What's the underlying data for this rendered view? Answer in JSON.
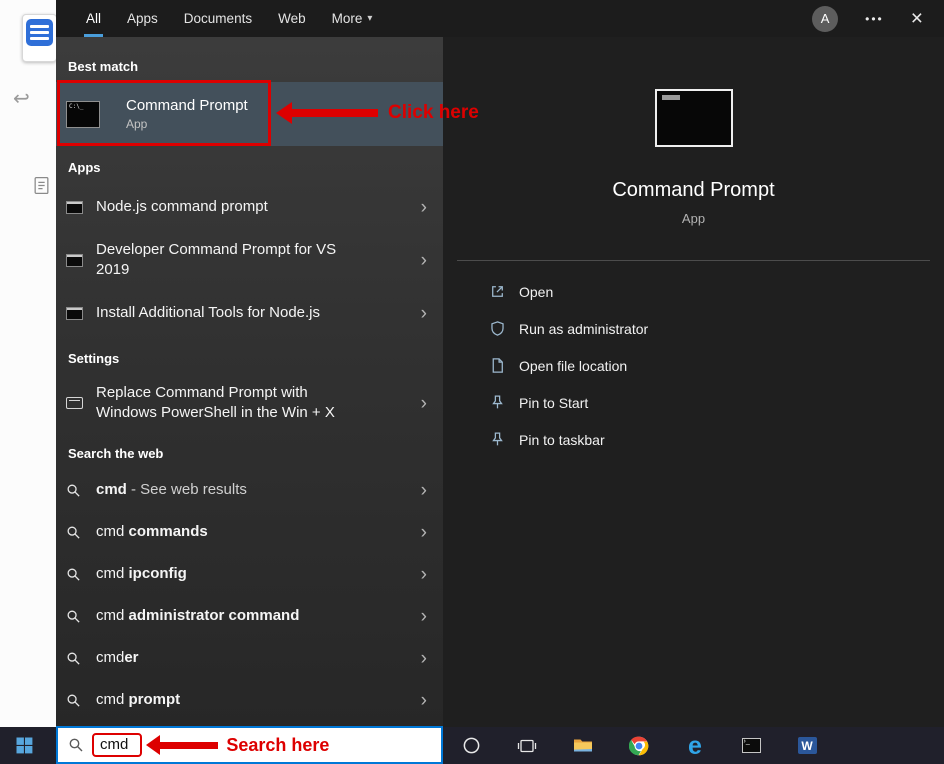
{
  "topbar": {
    "tabs": [
      {
        "label": "All",
        "selected": true
      },
      {
        "label": "Apps",
        "selected": false
      },
      {
        "label": "Documents",
        "selected": false
      },
      {
        "label": "Web",
        "selected": false
      },
      {
        "label": "More",
        "selected": false,
        "caret": "▾"
      }
    ],
    "avatar_letter": "A",
    "ellipsis_icon": "•••",
    "close_icon": "×"
  },
  "left_panel": {
    "best_match_header": "Best match",
    "best_match": {
      "title": "Command Prompt",
      "subtitle": "App",
      "icon": "command-prompt-icon"
    },
    "sections": [
      {
        "header": "Apps",
        "type": "app",
        "item_icon": "terminal-window-icon",
        "items": [
          {
            "text": "Node.js command prompt"
          },
          {
            "text": "Developer Command Prompt for VS 2019",
            "two_line": true
          },
          {
            "text": "Install Additional Tools for Node.js"
          }
        ]
      },
      {
        "header": "Settings",
        "type": "settings",
        "item_icon": "window-outline-icon",
        "items": [
          {
            "text": "Replace Command Prompt with Windows PowerShell in the Win + X",
            "two_line": true
          }
        ]
      },
      {
        "header": "Search the web",
        "type": "web",
        "item_icon": "search-icon",
        "items": [
          {
            "query": "cmd",
            "suffix": " - See web results",
            "bold_query": true,
            "dim_suffix": true
          },
          {
            "query": "cmd ",
            "suffix": "commands",
            "bold_suffix": true
          },
          {
            "query": "cmd ",
            "suffix": "ipconfig",
            "bold_suffix": true
          },
          {
            "query": "cmd ",
            "suffix": "administrator command",
            "bold_suffix": true
          },
          {
            "query": "cmd",
            "suffix": "er",
            "bold_suffix": true
          },
          {
            "query": "cmd ",
            "suffix": "prompt",
            "bold_suffix": true
          }
        ]
      }
    ]
  },
  "preview_panel": {
    "title": "Command Prompt",
    "subtitle": "App",
    "icon": "command-prompt-icon-large",
    "actions": [
      {
        "label": "Open",
        "icon": "open-external-icon"
      },
      {
        "label": "Run as administrator",
        "icon": "shield-icon"
      },
      {
        "label": "Open file location",
        "icon": "file-location-icon"
      },
      {
        "label": "Pin to Start",
        "icon": "pin-icon"
      },
      {
        "label": "Pin to taskbar",
        "icon": "pin-icon"
      }
    ]
  },
  "annotations": {
    "click_here": "Click here",
    "search_here": "Search here"
  },
  "search_box": {
    "value": "cmd"
  },
  "taskbar": {
    "start": {
      "icon": "windows-logo-icon"
    },
    "items": [
      {
        "name": "cortana-button",
        "icon": "cortana-icon"
      },
      {
        "name": "task-view-button",
        "icon": "task-view-icon"
      },
      {
        "name": "file-explorer-button",
        "icon": "file-explorer-icon"
      },
      {
        "name": "chrome-button",
        "icon": "chrome-icon"
      },
      {
        "name": "edge-button",
        "icon": "edge-icon"
      },
      {
        "name": "command-prompt-button",
        "icon": "command-prompt-icon"
      },
      {
        "name": "word-button",
        "icon": "word-icon"
      }
    ]
  },
  "colors": {
    "accent_blue": "#4a9edb",
    "search_border_blue": "#0078d7",
    "annotation_red": "#dd0000",
    "best_match_highlight": "#43505b"
  }
}
